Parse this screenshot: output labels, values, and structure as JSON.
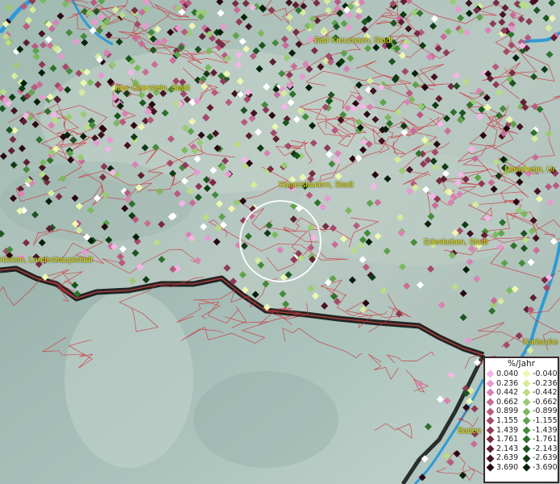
{
  "places": [
    {
      "name": "Bad Kreuznach, Stadt"
    },
    {
      "name": "Idar-Oberstein, Stadt"
    },
    {
      "name": "Kaiserslautern, Stadt"
    },
    {
      "name": "Mannheim, Ur"
    },
    {
      "name": "Edenkoben, Stadt"
    },
    {
      "name": "rücken, Landeshauptstadt"
    },
    {
      "name": "Karlsruhe"
    },
    {
      "name": "Baden"
    }
  ],
  "legend": {
    "title": "%/Jahr",
    "positive": [
      {
        "label": "0.040",
        "color": "#f4b6e6"
      },
      {
        "label": "0.236",
        "color": "#e79ad0"
      },
      {
        "label": "0.442",
        "color": "#d983b4"
      },
      {
        "label": "0.662",
        "color": "#c96d98"
      },
      {
        "label": "0.899",
        "color": "#b85a80"
      },
      {
        "label": "1.155",
        "color": "#a34a6a"
      },
      {
        "label": "1.439",
        "color": "#8e3a56"
      },
      {
        "label": "1.761",
        "color": "#782c44"
      },
      {
        "label": "2.143",
        "color": "#5f1f32"
      },
      {
        "label": "2.639",
        "color": "#451322"
      },
      {
        "label": "3.690",
        "color": "#2a0812"
      }
    ],
    "negative": [
      {
        "label": "-0.040",
        "color": "#eef7b0"
      },
      {
        "label": "-0.236",
        "color": "#d6ec9c"
      },
      {
        "label": "-0.442",
        "color": "#b9dd86"
      },
      {
        "label": "-0.662",
        "color": "#9acb72"
      },
      {
        "label": "-0.899",
        "color": "#7cb85e"
      },
      {
        "label": "-1.155",
        "color": "#5fa24b"
      },
      {
        "label": "-1.439",
        "color": "#468a3b"
      },
      {
        "label": "-1.761",
        "color": "#2f712c"
      },
      {
        "label": "-2.143",
        "color": "#1d5520"
      },
      {
        "label": "-2.639",
        "color": "#103b14"
      },
      {
        "label": "-3.690",
        "color": "#05210a"
      }
    ]
  }
}
